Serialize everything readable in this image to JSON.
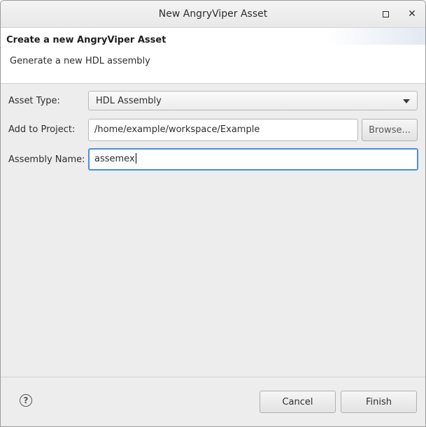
{
  "window": {
    "title": "New AngryViper Asset",
    "maximize_icon": "maximize-icon",
    "close_icon": "close-icon",
    "close_glyph": "✕"
  },
  "banner": {
    "title": "Create a new AngryViper Asset",
    "description": "Generate a new HDL assembly"
  },
  "form": {
    "asset_type": {
      "label": "Asset Type:",
      "selected": "HDL Assembly"
    },
    "project": {
      "label": "Add to Project:",
      "value": "/home/example/workspace/Example",
      "browse_label": "Browse..."
    },
    "assembly_name": {
      "label": "Assembly Name:",
      "value": "assemex"
    }
  },
  "footer": {
    "help_icon": "help-icon",
    "help_glyph": "?",
    "cancel_label": "Cancel",
    "finish_label": "Finish"
  },
  "colors": {
    "focus_border": "#4a90d9",
    "dialog_background": "#ededed"
  }
}
